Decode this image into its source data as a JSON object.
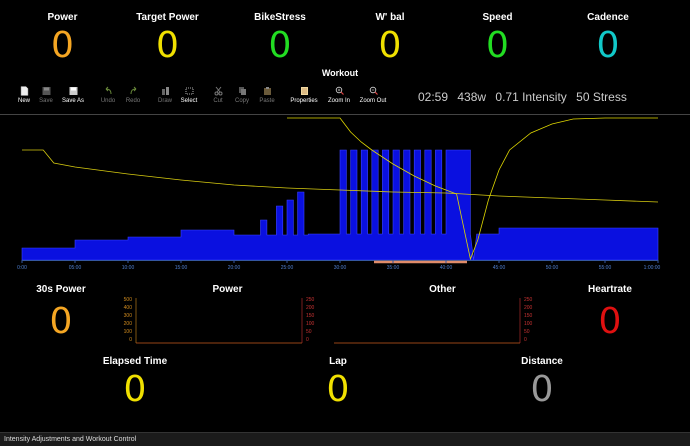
{
  "top_metrics": [
    {
      "label": "Power",
      "value": "0",
      "color": "#f5a623"
    },
    {
      "label": "Target Power",
      "value": "0",
      "color": "#f0e000"
    },
    {
      "label": "BikeStress",
      "value": "0",
      "color": "#22dd22"
    },
    {
      "label": "W' bal",
      "value": "0",
      "color": "#f0e000"
    },
    {
      "label": "Speed",
      "value": "0",
      "color": "#22dd22"
    },
    {
      "label": "Cadence",
      "value": "0",
      "color": "#11c8c8"
    }
  ],
  "workout": {
    "title": "Workout",
    "toolbar": [
      {
        "label": "New",
        "icon": "new-file-icon",
        "enabled": true
      },
      {
        "label": "Save",
        "icon": "save-icon",
        "enabled": false
      },
      {
        "label": "Save As",
        "icon": "save-as-icon",
        "enabled": true
      },
      {
        "label": "Undo",
        "icon": "undo-icon",
        "enabled": false
      },
      {
        "label": "Redo",
        "icon": "redo-icon",
        "enabled": false
      },
      {
        "label": "Draw",
        "icon": "draw-icon",
        "enabled": false
      },
      {
        "label": "Select",
        "icon": "select-icon",
        "enabled": true
      },
      {
        "label": "Cut",
        "icon": "cut-icon",
        "enabled": false
      },
      {
        "label": "Copy",
        "icon": "copy-icon",
        "enabled": false
      },
      {
        "label": "Paste",
        "icon": "paste-icon",
        "enabled": false
      },
      {
        "label": "Properties",
        "icon": "properties-icon",
        "enabled": true
      },
      {
        "label": "Zoom In",
        "icon": "zoom-in-icon",
        "enabled": true
      },
      {
        "label": "Zoom Out",
        "icon": "zoom-out-icon",
        "enabled": true
      }
    ],
    "stats": {
      "duration": "02:59",
      "watts": "438w",
      "intensity": "0.71 Intensity",
      "stress": "50 Stress"
    }
  },
  "chart_data": {
    "type": "area",
    "x_unit": "minutes",
    "xlim": [
      0,
      60
    ],
    "x_ticks": [
      "0:00",
      "05:00",
      "10:00",
      "15:00",
      "20:00",
      "25:00",
      "30:00",
      "35:00",
      "40:00",
      "45:00",
      "50:00",
      "55:00",
      "1:00:00"
    ],
    "series": [
      {
        "kind": "power-blocks",
        "color": "#0a10e0",
        "points": [
          [
            0,
            12
          ],
          [
            5,
            12
          ],
          [
            5,
            20
          ],
          [
            10,
            20
          ],
          [
            10,
            23
          ],
          [
            15,
            23
          ],
          [
            15,
            30
          ],
          [
            20,
            30
          ],
          [
            20,
            25
          ],
          [
            22.5,
            25
          ],
          [
            22.5,
            40
          ],
          [
            23.1,
            40
          ],
          [
            23.1,
            25
          ],
          [
            24,
            25
          ],
          [
            24,
            54
          ],
          [
            24.6,
            54
          ],
          [
            24.6,
            25
          ],
          [
            25,
            25
          ],
          [
            25,
            60
          ],
          [
            25.6,
            60
          ],
          [
            25.6,
            25
          ],
          [
            26,
            25
          ],
          [
            26,
            68
          ],
          [
            26.6,
            68
          ],
          [
            26.6,
            25
          ],
          [
            27,
            25
          ],
          [
            27,
            26
          ],
          [
            30,
            26
          ],
          [
            30,
            110
          ],
          [
            30.6,
            110
          ],
          [
            30.6,
            26
          ],
          [
            31,
            26
          ],
          [
            31,
            110
          ],
          [
            31.6,
            110
          ],
          [
            31.6,
            26
          ],
          [
            32,
            26
          ],
          [
            32,
            110
          ],
          [
            32.6,
            110
          ],
          [
            32.6,
            26
          ],
          [
            33,
            26
          ],
          [
            33,
            110
          ],
          [
            33.6,
            110
          ],
          [
            33.6,
            26
          ],
          [
            34,
            26
          ],
          [
            34,
            110
          ],
          [
            34.6,
            110
          ],
          [
            34.6,
            26
          ],
          [
            35,
            26
          ],
          [
            35,
            110
          ],
          [
            35.6,
            110
          ],
          [
            35.6,
            26
          ],
          [
            36,
            26
          ],
          [
            36,
            110
          ],
          [
            36.6,
            110
          ],
          [
            36.6,
            26
          ],
          [
            37,
            26
          ],
          [
            37,
            110
          ],
          [
            37.6,
            110
          ],
          [
            37.6,
            26
          ],
          [
            38,
            26
          ],
          [
            38,
            110
          ],
          [
            38.6,
            110
          ],
          [
            38.6,
            26
          ],
          [
            39,
            26
          ],
          [
            39,
            110
          ],
          [
            39.6,
            110
          ],
          [
            39.6,
            26
          ],
          [
            40,
            26
          ],
          [
            40,
            110
          ],
          [
            42.3,
            110
          ],
          [
            42.3,
            26
          ],
          [
            42.3,
            26
          ],
          [
            42.6,
            0
          ],
          [
            42.9,
            26
          ],
          [
            45,
            26
          ],
          [
            45,
            32
          ],
          [
            60,
            32
          ]
        ]
      },
      {
        "kind": "power-target",
        "color": "#f0e000",
        "points": [
          [
            0,
            110
          ],
          [
            2,
            110
          ],
          [
            3,
            97
          ],
          [
            5,
            93
          ],
          [
            10,
            86
          ],
          [
            15,
            80
          ],
          [
            20,
            75
          ],
          [
            25,
            72
          ],
          [
            30,
            70
          ],
          [
            35,
            68
          ],
          [
            40,
            67
          ],
          [
            45,
            64
          ],
          [
            50,
            62
          ],
          [
            55,
            60
          ],
          [
            60,
            58
          ]
        ]
      },
      {
        "kind": "wbal",
        "color": "#f0e000",
        "points": [
          [
            25,
            146
          ],
          [
            30,
            146
          ],
          [
            30,
            146
          ],
          [
            31,
            128
          ],
          [
            32,
            118
          ],
          [
            33,
            110
          ],
          [
            34,
            103
          ],
          [
            35,
            96
          ],
          [
            36,
            90
          ],
          [
            37,
            84
          ],
          [
            38,
            79
          ],
          [
            39,
            74
          ],
          [
            40,
            70
          ],
          [
            41,
            66
          ],
          [
            42.3,
            1
          ],
          [
            43,
            20
          ],
          [
            44,
            60
          ],
          [
            45,
            90
          ],
          [
            46,
            110
          ],
          [
            48,
            127
          ],
          [
            50,
            136
          ],
          [
            52,
            141
          ],
          [
            55,
            144
          ],
          [
            60,
            145
          ]
        ]
      }
    ]
  },
  "bottom_metrics": [
    {
      "label": "30s Power",
      "value": "0",
      "color": "#f5a623"
    },
    {
      "label": "Heartrate",
      "value": "0",
      "color": "#e01010"
    },
    {
      "label": "Elapsed Time",
      "value": "0",
      "color": "#f0e000"
    },
    {
      "label": "Lap",
      "value": "0",
      "color": "#f0e000"
    },
    {
      "label": "Distance",
      "value": "0",
      "color": "#999999"
    }
  ],
  "mini_plots": [
    {
      "title": "Power",
      "y_left_ticks": [
        "500",
        "400",
        "300",
        "200",
        "100",
        "0"
      ],
      "y_right_ticks": [
        "250",
        "200",
        "150",
        "100",
        "50",
        "0"
      ]
    },
    {
      "title": "Other",
      "y_left_ticks": [],
      "y_right_ticks": [
        "250",
        "200",
        "150",
        "100",
        "50",
        "0"
      ]
    }
  ],
  "status_bar": {
    "text": "Intensity Adjustments and Workout Control"
  }
}
